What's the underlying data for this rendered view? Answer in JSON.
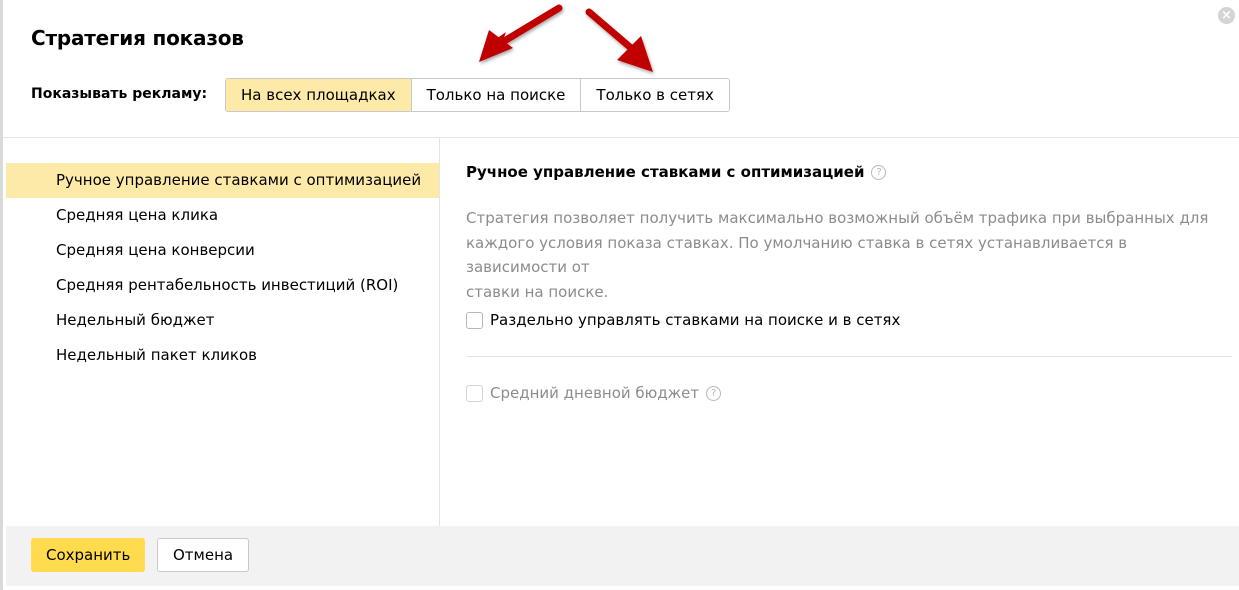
{
  "dialog": {
    "title": "Стратегия показов",
    "close_icon": "close-icon"
  },
  "placement": {
    "label": "Показывать рекламу:",
    "options": [
      "На всех площадках",
      "Только на поиске",
      "Только в сетях"
    ],
    "selected": "На всех площадках"
  },
  "strategies": {
    "items": [
      "Ручное управление ставками с оптимизацией",
      "Средняя цена клика",
      "Средняя цена конверсии",
      "Средняя рентабельность инвестиций (ROI)",
      "Недельный бюджет",
      "Недельный пакет кликов"
    ],
    "selected": "Ручное управление ставками с оптимизацией"
  },
  "detail": {
    "title": "Ручное управление ставками с оптимизацией",
    "help_icon": "question-icon",
    "description_lines": [
      "Стратегия позволяет получить максимально возможный объём трафика при выбранных для",
      "каждого условия показа ставках. По умолчанию ставка в сетях устанавливается в зависимости от",
      "ставки на поиске."
    ],
    "separate_bids_label": "Раздельно управлять ставками на поиске и в сетях",
    "separate_bids_checked": false,
    "daily_budget_label": "Средний дневной бюджет",
    "daily_budget_checked": false,
    "daily_budget_disabled": true
  },
  "footer": {
    "save_label": "Сохранить",
    "cancel_label": "Отмена"
  },
  "colors": {
    "selected_bg": "#fdeaa8",
    "primary_button": "#ffdb4d",
    "annotation_arrow": "#c00000",
    "muted_text": "#8c8c8c"
  }
}
